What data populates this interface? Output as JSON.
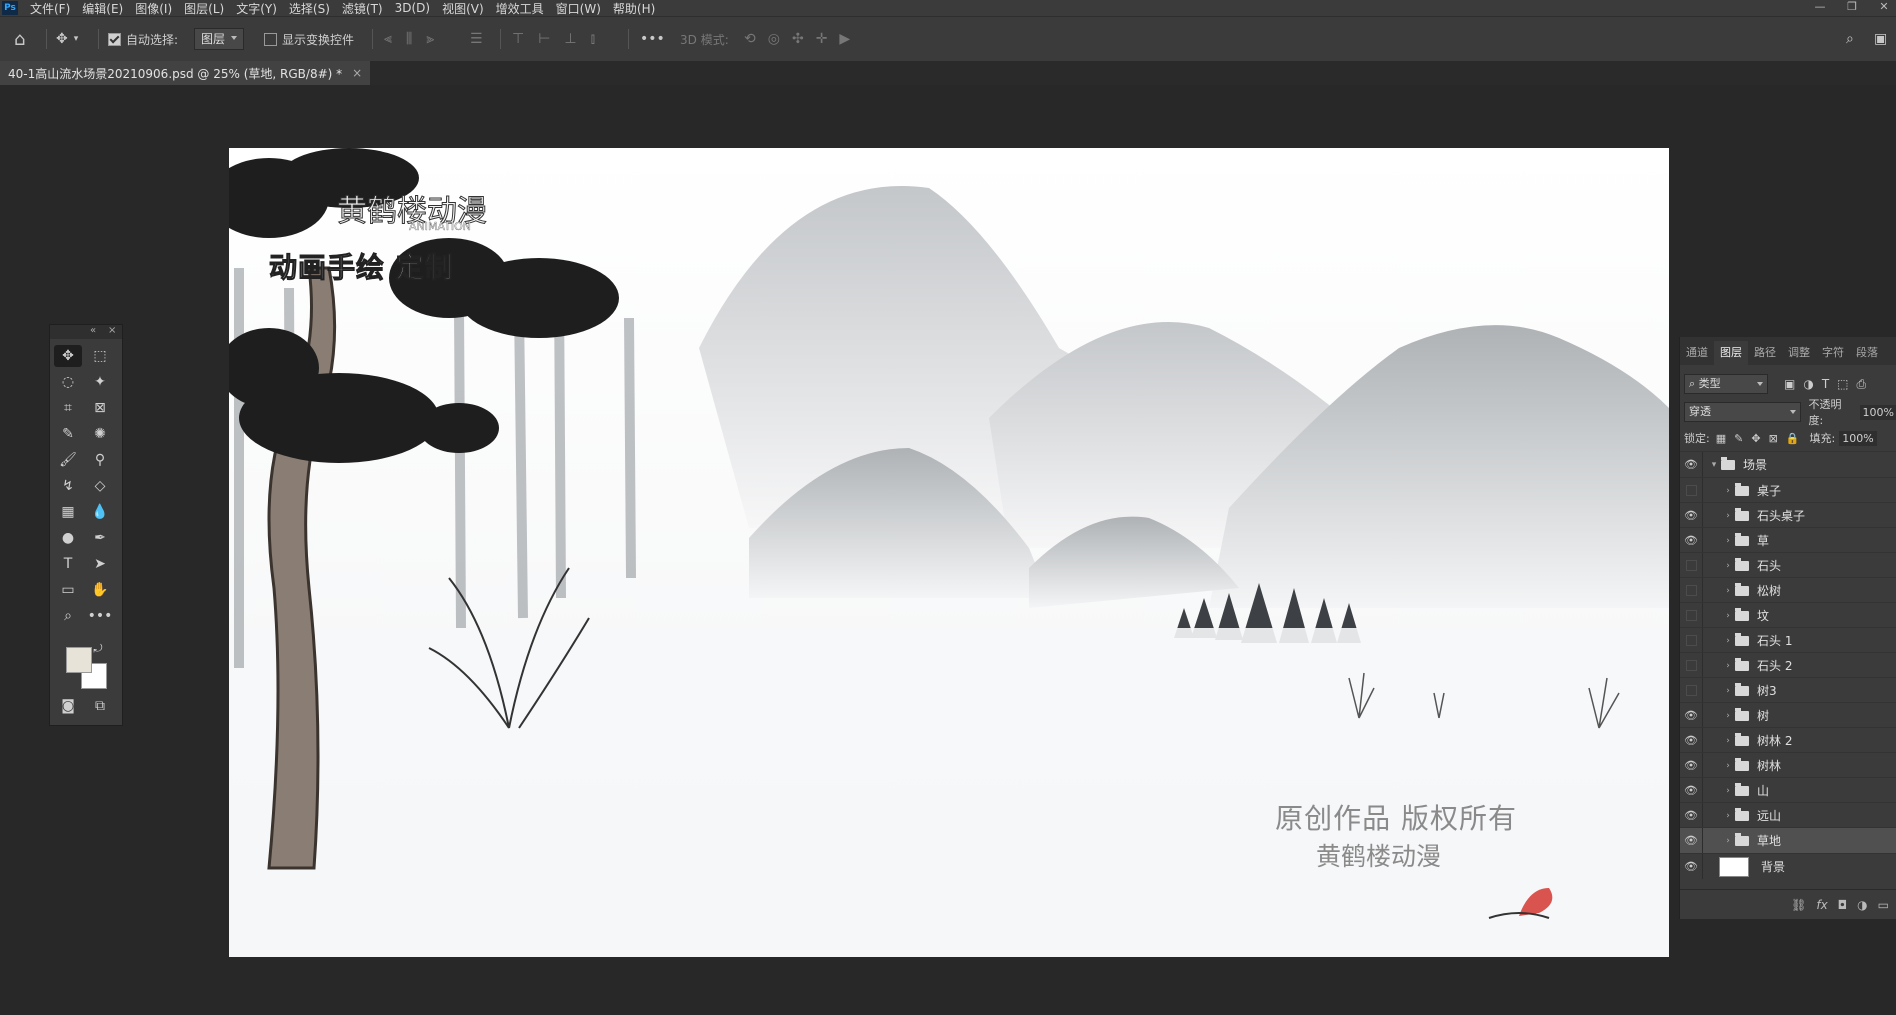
{
  "menubar": {
    "logo": "Ps",
    "items": [
      "文件(F)",
      "编辑(E)",
      "图像(I)",
      "图层(L)",
      "文字(Y)",
      "选择(S)",
      "滤镜(T)",
      "3D(D)",
      "视图(V)",
      "增效工具",
      "窗口(W)",
      "帮助(H)"
    ]
  },
  "options": {
    "auto_select_label": "自动选择:",
    "auto_select_value": "图层",
    "show_transform_label": "显示变换控件",
    "mode_3d_label": "3D 模式:",
    "more": "•••"
  },
  "document": {
    "tab_title": "40-1高山流水场景20210906.psd @ 25% (草地, RGB/8#) *",
    "close": "×"
  },
  "canvas": {
    "logo_brand": "黄鹤楼动漫",
    "logo_sub": "ANIMATION",
    "logo_slogan": "动画手绘  定制",
    "watermark_line1": "原创作品 版权所有",
    "watermark_line2": "黄鹤楼动漫"
  },
  "layers_panel": {
    "tabs": [
      "通道",
      "图层",
      "路径",
      "调整",
      "字符",
      "段落"
    ],
    "active_tab": "图层",
    "filter_kind": "类型",
    "blend_mode": "穿透",
    "opacity_label": "不透明度:",
    "opacity_value": "100%",
    "lock_label": "锁定:",
    "fill_label": "填充:",
    "fill_value": "100%",
    "group_name": "场景",
    "layers": [
      {
        "name": "桌子",
        "visible": false
      },
      {
        "name": "石头桌子",
        "visible": true
      },
      {
        "name": "草",
        "visible": true
      },
      {
        "name": "石头",
        "visible": false
      },
      {
        "name": "松树",
        "visible": false
      },
      {
        "name": "坟",
        "visible": false
      },
      {
        "name": "石头 1",
        "visible": false
      },
      {
        "name": "石头 2",
        "visible": false
      },
      {
        "name": "树3",
        "visible": false
      },
      {
        "name": "树",
        "visible": true
      },
      {
        "name": "树林 2",
        "visible": true
      },
      {
        "name": "树林",
        "visible": true
      },
      {
        "name": "山",
        "visible": true
      },
      {
        "name": "远山",
        "visible": true
      },
      {
        "name": "草地",
        "visible": true,
        "selected": true
      }
    ],
    "background_layer": "背景"
  }
}
